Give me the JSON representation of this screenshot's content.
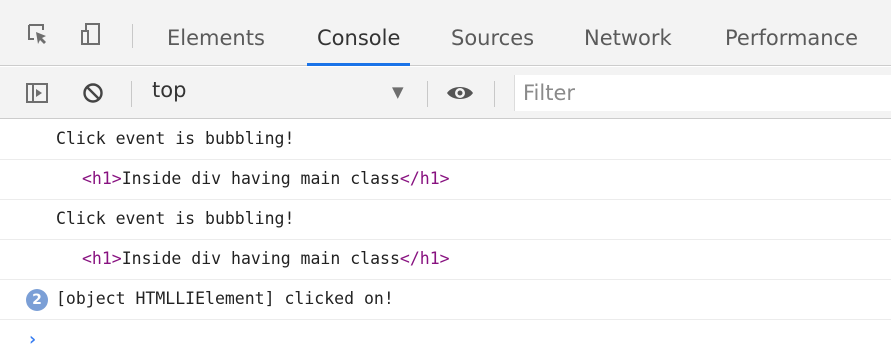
{
  "tabs": [
    {
      "label": "Elements"
    },
    {
      "label": "Console"
    },
    {
      "label": "Sources"
    },
    {
      "label": "Network"
    },
    {
      "label": "Performance"
    }
  ],
  "active_tab": "Console",
  "toolbar": {
    "context": "top",
    "filter_placeholder": "Filter"
  },
  "console": {
    "messages": [
      {
        "text": "Click event is bubbling!"
      },
      {
        "open_tag": "<h1>",
        "content": "Inside div having main class",
        "close_tag": "</h1>"
      },
      {
        "text": "Click event is bubbling!"
      },
      {
        "open_tag": "<h1>",
        "content": "Inside div having main class",
        "close_tag": "</h1>"
      },
      {
        "repeat_count": "2",
        "text": "[object HTMLLIElement] clicked on!"
      }
    ],
    "prompt_symbol": "›"
  },
  "colors": {
    "accent": "#1a73e8",
    "tag": "#881280",
    "badge": "#7b9fd6",
    "prompt": "#367cf1"
  },
  "icons": [
    "inspect-element-icon",
    "device-toggle-icon",
    "sidebar-toggle-icon",
    "clear-console-icon",
    "dropdown-arrow-icon",
    "eye-icon"
  ]
}
